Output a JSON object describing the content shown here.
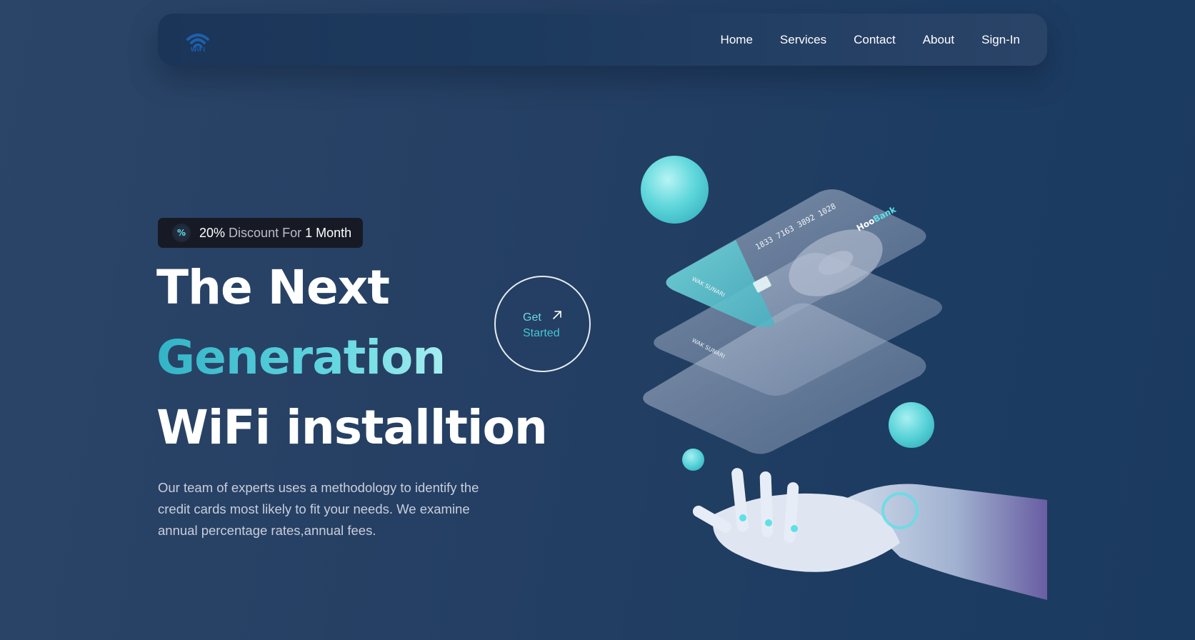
{
  "nav": {
    "logo_text": "WiFi",
    "links": [
      "Home",
      "Services",
      "Contact",
      "About",
      "Sign-In"
    ]
  },
  "hero": {
    "badge": {
      "percent": "20%",
      "mid": "Discount For",
      "one": "1",
      "end": "Month",
      "icon": "discount-icon"
    },
    "headline": {
      "line1": "The Next",
      "line2": "Generation",
      "line3": "WiFi installtion"
    },
    "description": "Our team of experts uses a methodology to identify the credit cards most likely to fit your needs. We examine annual percentage rates,annual fees.",
    "cta": {
      "line1": "Get",
      "line2": "Started",
      "icon": "arrow-up-right-icon"
    }
  },
  "art": {
    "card_number": "1833 7163 3892 1028",
    "card_brand_a": "Hoo",
    "card_brand_b": "Bank",
    "card_holder": "WAK SUNARI"
  },
  "colors": {
    "background": "#243f63",
    "accent": "#5ee0e6",
    "navbar": "#1c3a5e"
  }
}
